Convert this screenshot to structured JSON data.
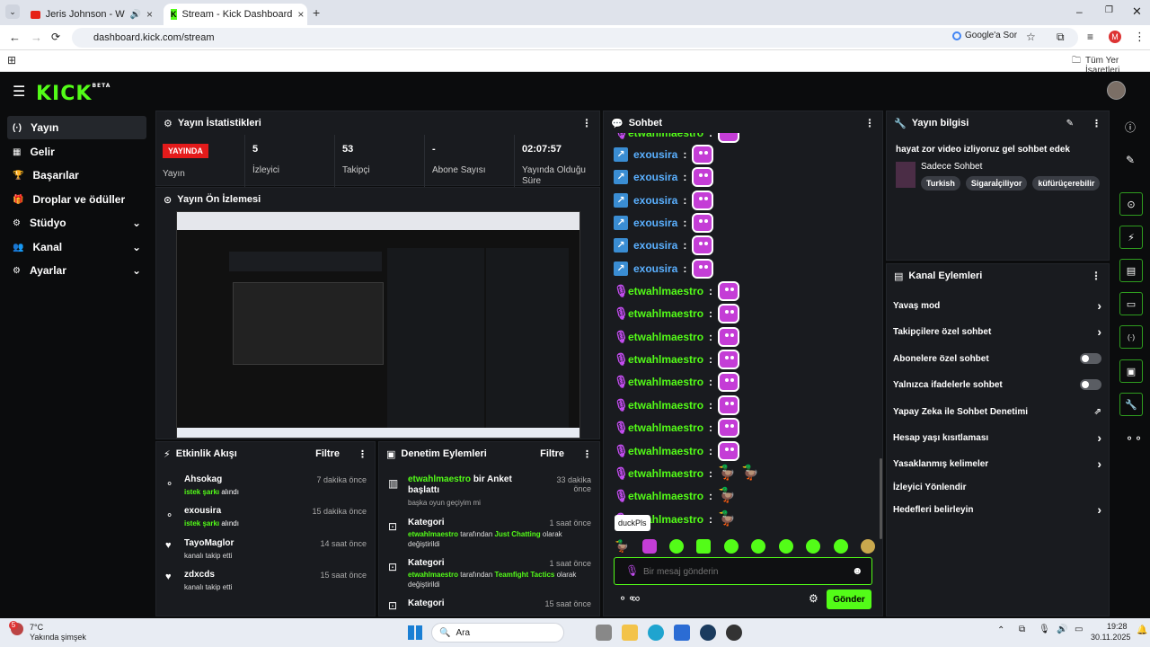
{
  "browser": {
    "tab1": "Jeris Johnson - When The D",
    "tab2": "Stream - Kick Dashboard",
    "url": "dashboard.kick.com/stream",
    "google_lens": "Google'a Sor",
    "avatar_letter": "M",
    "bookmarks_label": "Tüm Yer İşaretleri",
    "add_tab": "+"
  },
  "app": {
    "logo": "KICK",
    "logo_badge": "BETA"
  },
  "nav": [
    {
      "label": "Yayın",
      "icon": "(·)"
    },
    {
      "label": "Gelir",
      "icon": "▦"
    },
    {
      "label": "Başarılar",
      "icon": "🏆"
    },
    {
      "label": "Droplar ve ödüller",
      "icon": "🎁"
    },
    {
      "label": "Stüdyo",
      "icon": "⚙"
    },
    {
      "label": "Kanal",
      "icon": "👥"
    },
    {
      "label": "Ayarlar",
      "icon": "⚙"
    }
  ],
  "stats": {
    "title": "Yayın İstatistikleri",
    "live_badge": "YAYINDA",
    "live_label": "Yayın",
    "viewers_value": "5",
    "viewers_label": "İzleyici",
    "followers_value": "53",
    "followers_label": "Takipçi",
    "subs_value": "-",
    "subs_label": "Abone Sayısı",
    "duration_value": "02:07:57",
    "duration_label": "Yayında Olduğu Süre"
  },
  "preview": {
    "title": "Yayın Ön İzlemesi"
  },
  "activity": {
    "title": "Etkinlik Akışı",
    "filter": "Filtre",
    "items": [
      {
        "name": "Ahsokag",
        "time": "7 dakika önce",
        "action": "istek şarkı",
        "suffix": "alındı"
      },
      {
        "name": "exousira",
        "time": "15 dakika önce",
        "action": "istek şarkı",
        "suffix": "alındı"
      },
      {
        "name": "TayoMaglor",
        "time": "14 saat önce",
        "action": "",
        "suffix": "kanalı takip etti"
      },
      {
        "name": "zdxcds",
        "time": "15 saat önce",
        "action": "",
        "suffix": "kanalı takip etti"
      }
    ]
  },
  "moderation": {
    "title": "Denetim Eylemleri",
    "filter": "Filtre",
    "items": [
      {
        "user": "etwahlmaestro",
        "title": "bir Anket başlattı",
        "time": "33 dakika önce",
        "desc": "başka oyun geçiyim mi"
      },
      {
        "user": "",
        "title": "Kategori",
        "time": "1 saat önce",
        "desc_user": "etwahlmaestro",
        "desc_mid": "tarafından",
        "desc_cat": "Just Chatting",
        "desc_end": "olarak değiştirildi"
      },
      {
        "user": "",
        "title": "Kategori",
        "time": "1 saat önce",
        "desc_user": "etwahlmaestro",
        "desc_mid": "tarafından",
        "desc_cat": "Teamfight Tactics",
        "desc_end": "olarak değiştirildi"
      },
      {
        "user": "",
        "title": "Kategori",
        "time": "15 saat önce"
      }
    ]
  },
  "chat": {
    "title": "Sohbet",
    "placeholder": "Bir mesaj gönderin",
    "send": "Gönder",
    "tooltip": "duckPls",
    "messages": [
      {
        "user": "etwahlmaestro",
        "kind": "partial"
      },
      {
        "user": "exousira",
        "kind": "k"
      },
      {
        "user": "exousira",
        "kind": "k"
      },
      {
        "user": "exousira",
        "kind": "k"
      },
      {
        "user": "exousira",
        "kind": "k"
      },
      {
        "user": "exousira",
        "kind": "k"
      },
      {
        "user": "exousira",
        "kind": "k"
      },
      {
        "user": "etwahlmaestro",
        "kind": "m"
      },
      {
        "user": "etwahlmaestro",
        "kind": "m"
      },
      {
        "user": "etwahlmaestro",
        "kind": "m"
      },
      {
        "user": "etwahlmaestro",
        "kind": "m"
      },
      {
        "user": "etwahlmaestro",
        "kind": "m"
      },
      {
        "user": "etwahlmaestro",
        "kind": "m"
      },
      {
        "user": "etwahlmaestro",
        "kind": "m"
      },
      {
        "user": "etwahlmaestro",
        "kind": "duck2"
      },
      {
        "user": "etwahlmaestro",
        "kind": "duck"
      },
      {
        "user": "etwahlmaestro",
        "kind": "duck"
      }
    ]
  },
  "streaminfo": {
    "title": "Yayın bilgisi",
    "stream_title": "hayat zor video izliyoruz gel sohbet edek",
    "category": "Sadece Sohbet",
    "tags": [
      "Turkish",
      "Sigaraİçiliyor",
      "küfürüçerebilir"
    ]
  },
  "channel_actions": {
    "title": "Kanal Eylemleri",
    "items": [
      {
        "label": "Yavaş mod",
        "ctrl": "arrow"
      },
      {
        "label": "Takipçilere özel sohbet",
        "ctrl": "arrow"
      },
      {
        "label": "Abonelere özel sohbet",
        "ctrl": "toggle"
      },
      {
        "label": "Yalnızca ifadelerle sohbet",
        "ctrl": "toggle"
      },
      {
        "label": "Yapay Zeka ile Sohbet Denetimi",
        "ctrl": "ext"
      },
      {
        "label": "Hesap yaşı kısıtlaması",
        "ctrl": "arrow"
      },
      {
        "label": "Yasaklanmış kelimeler",
        "ctrl": "arrow"
      },
      {
        "label": "İzleyici Yönlendir",
        "ctrl": "none"
      },
      {
        "label": "Hedefleri belirleyin",
        "ctrl": "arrow"
      }
    ]
  },
  "taskbar": {
    "weather_temp": "7°C",
    "weather_text": "Yakında şimşek",
    "search": "Ara",
    "time": "19:28",
    "date": "30.11.2025",
    "badge": "5"
  }
}
